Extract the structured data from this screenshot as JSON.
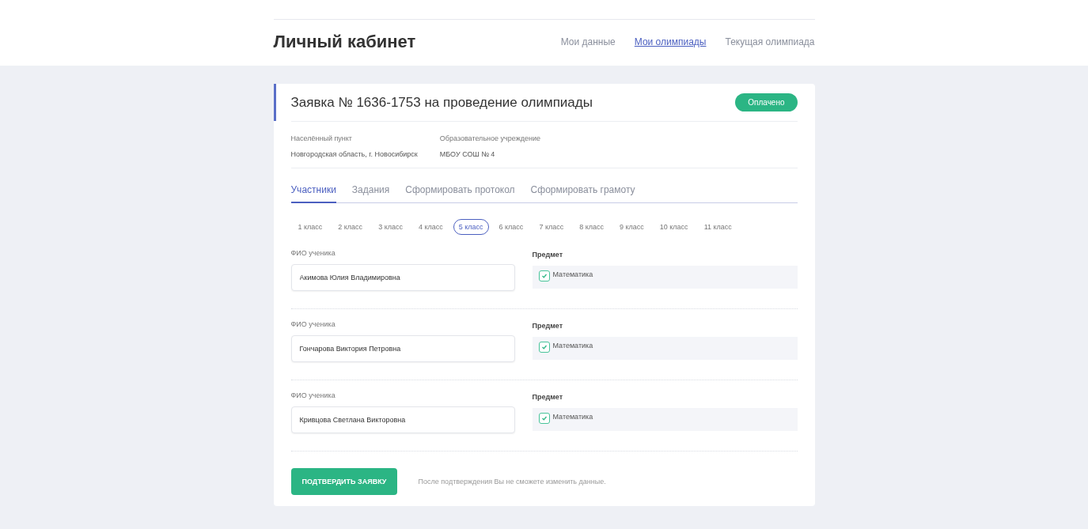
{
  "header": {
    "title": "Личный кабинет",
    "nav": [
      {
        "label": "Мои данные",
        "selected": false
      },
      {
        "label": "Мои олимпиады",
        "selected": true
      },
      {
        "label": "Текущая олимпиада",
        "selected": false
      }
    ]
  },
  "application": {
    "title": "Заявка № 1636-1753 на проведение олимпиады",
    "status": "Оплачено",
    "info": [
      {
        "label": "Населённый пункт",
        "value": "Новгородская область, г. Новосибирск"
      },
      {
        "label": "Образовательное учреждение",
        "value": "МБОУ СОШ № 4"
      }
    ],
    "tabs": [
      {
        "label": "Участники",
        "selected": true
      },
      {
        "label": "Задания",
        "selected": false
      },
      {
        "label": "Сформировать протокол",
        "selected": false
      },
      {
        "label": "Сформировать грамоту",
        "selected": false
      }
    ],
    "grades": [
      {
        "label": "1 класс",
        "selected": false
      },
      {
        "label": "2 класс",
        "selected": false
      },
      {
        "label": "3 класс",
        "selected": false
      },
      {
        "label": "4 класс",
        "selected": false
      },
      {
        "label": "5 класс",
        "selected": true
      },
      {
        "label": "6 класс",
        "selected": false
      },
      {
        "label": "7 класс",
        "selected": false
      },
      {
        "label": "8 класс",
        "selected": false
      },
      {
        "label": "9 класс",
        "selected": false
      },
      {
        "label": "10 класс",
        "selected": false
      },
      {
        "label": "11 класс",
        "selected": false
      }
    ],
    "participants": [
      {
        "name_label": "ФИО ученика",
        "name": "Акимова Юлия Владимировна",
        "subject_label": "Предмет",
        "subjects": [
          {
            "label": "Математика",
            "checked": true
          }
        ]
      },
      {
        "name_label": "ФИО ученика",
        "name": "Гончарова Виктория Петровна",
        "subject_label": "Предмет",
        "subjects": [
          {
            "label": "Математика",
            "checked": true
          }
        ]
      },
      {
        "name_label": "ФИО ученика",
        "name": "Кривцова Светлана Викторовна",
        "subject_label": "Предмет",
        "subjects": [
          {
            "label": "Математика",
            "checked": true
          }
        ]
      }
    ],
    "confirm_button": "ПОДТВЕРДИТЬ ЗАЯВКУ",
    "confirm_note": "После подтверждения Вы не сможете изменить данные."
  }
}
